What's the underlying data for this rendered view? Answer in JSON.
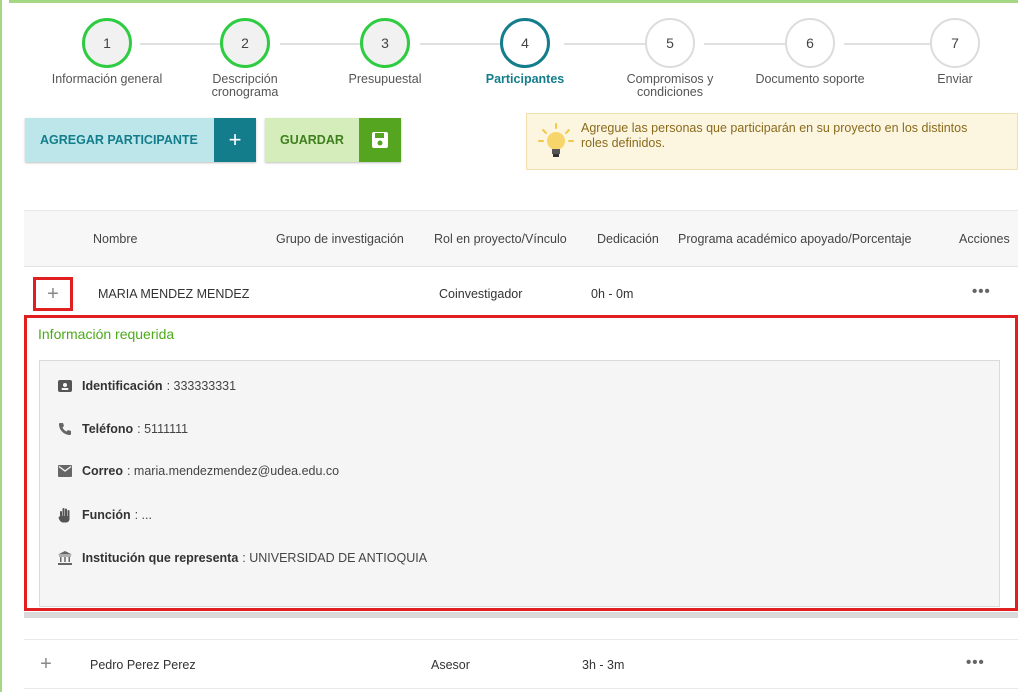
{
  "stepper": {
    "steps": [
      {
        "num": "1",
        "label": "Información general"
      },
      {
        "num": "2",
        "label": "Descripción cronograma"
      },
      {
        "num": "3",
        "label": "Presupuestal"
      },
      {
        "num": "4",
        "label": "Participantes"
      },
      {
        "num": "5",
        "label": "Compromisos y condiciones"
      },
      {
        "num": "6",
        "label": "Documento soporte"
      },
      {
        "num": "7",
        "label": "Enviar"
      }
    ],
    "active_step": "4"
  },
  "toolbar": {
    "add_label": "AGREGAR PARTICIPANTE",
    "add_icon": "plus-icon",
    "save_label": "GUARDAR",
    "save_icon": "floppy-disk-icon"
  },
  "tip": {
    "icon": "lightbulb-icon",
    "text_line1": "Agregue las personas que participarán en su proyecto en los distintos",
    "text_line2": "roles definidos."
  },
  "table": {
    "columns": [
      "Nombre",
      "Grupo de investigación",
      "Rol en proyecto/Vínculo",
      "Dedicación",
      "Programa académico apoyado/Porcentaje",
      "Acciones"
    ],
    "rows": [
      {
        "expand": "+",
        "nombre": "MARIA MENDEZ MENDEZ",
        "grupo": "",
        "rol": "Coinvestigador",
        "dedicacion": "0h - 0m",
        "programa": "",
        "acciones": "•••"
      },
      {
        "expand": "+",
        "nombre": "Pedro Perez Perez",
        "grupo": "",
        "rol": "Asesor",
        "dedicacion": "3h - 3m",
        "programa": "",
        "acciones": "•••"
      }
    ]
  },
  "detail": {
    "title": "Información requerida",
    "identificacion": {
      "label": "Identificación",
      "value": ": 333333331",
      "icon": "id-card-icon"
    },
    "telefono": {
      "label": "Teléfono",
      "value": ": 5111111",
      "icon": "phone-icon"
    },
    "correo": {
      "label": "Correo",
      "value": ": maria.mendezmendez@udea.edu.co",
      "icon": "mail-icon"
    },
    "funcion": {
      "label": "Función",
      "value": ": ...",
      "icon": "hand-icon"
    },
    "institucion": {
      "label": "Institución que representa",
      "value": ": UNIVERSIDAD DE ANTIOQUIA",
      "icon": "bank-icon"
    }
  },
  "colors": {
    "primary_teal": "#137d8c",
    "success_green": "#56a520",
    "step_complete": "#2ecc40",
    "highlight_red": "#e02020",
    "tip_bg": "#fcf5e0"
  }
}
